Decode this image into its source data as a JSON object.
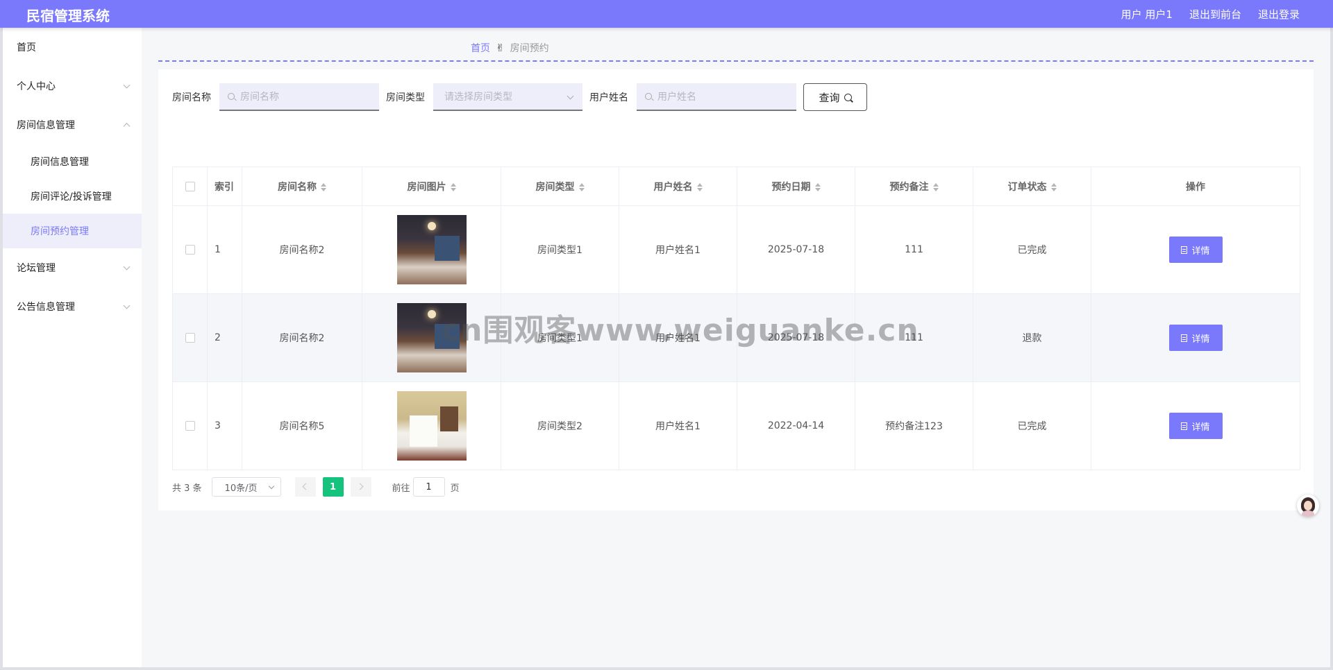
{
  "app": {
    "title": "民宿管理系统"
  },
  "topnav": {
    "user": "用户 用户1",
    "front": "退出到前台",
    "logout": "退出登录"
  },
  "sidebar": {
    "home": "首页",
    "personal": "个人中心",
    "room_group": "房间信息管理",
    "room_info": "房间信息管理",
    "room_comment": "房间评论/投诉管理",
    "room_booking": "房间预约管理",
    "forum": "论坛管理",
    "notice": "公告信息管理"
  },
  "breadcrumb": {
    "home": "首页",
    "separator": "✌",
    "current": "房间预约"
  },
  "search": {
    "room_name_label": "房间名称",
    "room_name_placeholder": "房间名称",
    "room_type_label": "房间类型",
    "room_type_placeholder": "请选择房间类型",
    "user_name_label": "用户姓名",
    "user_name_placeholder": "用户姓名",
    "query_button": "查询"
  },
  "table": {
    "headers": {
      "index": "索引",
      "room_name": "房间名称",
      "room_image": "房间图片",
      "room_type": "房间类型",
      "user_name": "用户姓名",
      "booking_date": "预约日期",
      "booking_note": "预约备注",
      "order_status": "订单状态",
      "actions": "操作"
    },
    "rows": [
      {
        "index": "1",
        "room_name": "房间名称2",
        "image": "dark-hotel-room",
        "room_type": "房间类型1",
        "user_name": "用户姓名1",
        "booking_date": "2025-07-18",
        "note": "111",
        "status": "已完成",
        "action": "详情"
      },
      {
        "index": "2",
        "room_name": "房间名称2",
        "image": "dark-hotel-room",
        "room_type": "房间类型1",
        "user_name": "用户姓名1",
        "booking_date": "2025-07-18",
        "note": "111",
        "status": "退款",
        "action": "详情"
      },
      {
        "index": "3",
        "room_name": "房间名称5",
        "image": "light-hotel-room",
        "room_type": "房间类型2",
        "user_name": "用户姓名1",
        "booking_date": "2022-04-14",
        "note": "预约备注123",
        "status": "已完成",
        "action": "详情"
      }
    ]
  },
  "pagination": {
    "total": "共 3 条",
    "page_size": "10条/页",
    "current_page": "1",
    "goto_label": "前往",
    "goto_value": "1",
    "page_suffix": "页"
  },
  "watermark": "cn围观客www.weiguanke.cn",
  "colors": {
    "accent": "#7b79fb",
    "active_page": "#15c37f"
  }
}
